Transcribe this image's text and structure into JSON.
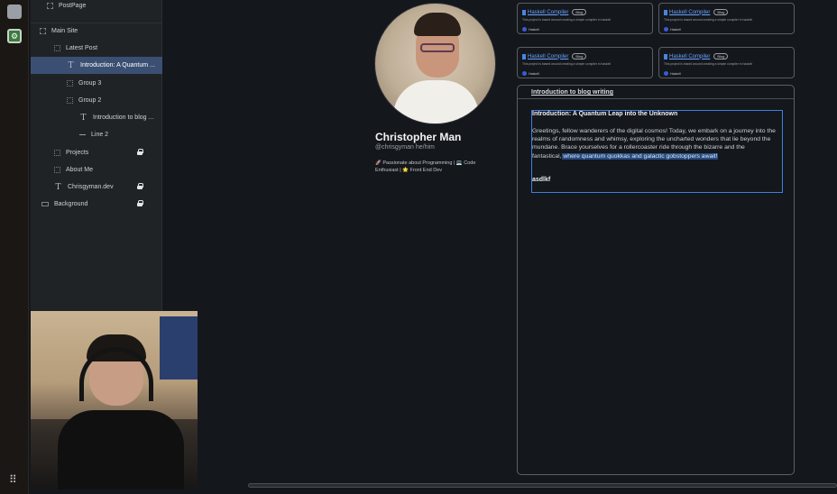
{
  "layers": {
    "items": [
      {
        "label": "PostPage",
        "icon": "frame-icon"
      },
      {
        "label": "Main Site",
        "icon": "frame-icon"
      },
      {
        "label": "Latest Post",
        "icon": "group-icon"
      },
      {
        "label": "Introduction: A Quantum ...",
        "icon": "text-icon",
        "selected": true
      },
      {
        "label": "Group 3",
        "icon": "group-icon"
      },
      {
        "label": "Group 2",
        "icon": "group-icon"
      },
      {
        "label": "Introduction to blog ...",
        "icon": "text-icon"
      },
      {
        "label": "Line 2",
        "icon": "line-icon"
      },
      {
        "label": "Projects",
        "icon": "group-icon",
        "locked": true
      },
      {
        "label": "About Me",
        "icon": "group-icon"
      },
      {
        "label": "Chrisgyman.dev",
        "icon": "text-icon",
        "locked": true
      },
      {
        "label": "Background",
        "icon": "rect-icon",
        "locked": true
      }
    ]
  },
  "profile": {
    "name": "Christopher Man",
    "handle": "@chrisgyman he/him",
    "bio": "🚀 Passionate about Programming | 💻 Code Enthusiast | 🌟 Front End Dev"
  },
  "cards": [
    {
      "title": "Haskell Compiler",
      "badge": "Blog",
      "desc": "This project is based around creating a simple compiler in haskell",
      "lang": "Haskell"
    },
    {
      "title": "Haskell Compiler",
      "badge": "Blog",
      "desc": "This project is based around creating a simple compiler in haskell",
      "lang": "Haskell"
    },
    {
      "title": "Haskell Compiler",
      "badge": "Blog",
      "desc": "This project is based around creating a simple compiler in haskell",
      "lang": "Haskell"
    },
    {
      "title": "Haskell Compiler",
      "badge": "Blog",
      "desc": "This project is based around creating a simple compiler in haskell",
      "lang": "Haskell"
    }
  ],
  "blog": {
    "heading": "Introduction to blog writing",
    "post_title": "Introduction: A Quantum Leap into the Unknown",
    "post_body": "Greetings, fellow wanderers of the digital cosmos! Today, we embark on a journey into the realms of randomness and whimsy, exploring the uncharted wonders that lie beyond the mundane. Brace yourselves for a rollercoaster ride through the bizarre and the fantastical,",
    "post_body_highlight": " where quantum quokkas and galactic gobstoppers await!",
    "post_sign": "asdlkf"
  },
  "colors": {
    "selection": "#3d7fe0",
    "link": "#6aa2ff",
    "selected_layer": "#3b4f73"
  }
}
